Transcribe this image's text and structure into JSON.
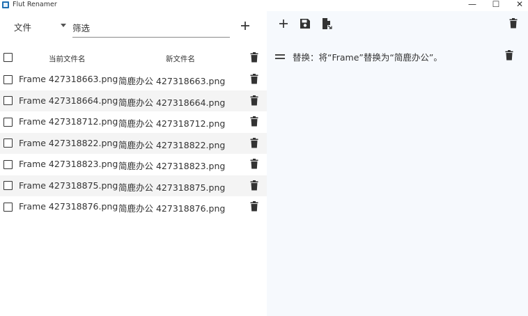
{
  "window": {
    "title": "Flut Renamer",
    "minimize_glyph": "—",
    "maximize_glyph": "☐",
    "close_glyph": "✕"
  },
  "left": {
    "file_menu_label": "文件",
    "filter_placeholder": "筛选",
    "columns": {
      "current": "当前文件名",
      "new": "新文件名"
    },
    "rows": [
      {
        "current": "Frame 427318663.png",
        "new": "简鹿办公 427318663.png"
      },
      {
        "current": "Frame 427318664.png",
        "new": "简鹿办公 427318664.png"
      },
      {
        "current": "Frame 427318712.png",
        "new": "简鹿办公 427318712.png"
      },
      {
        "current": "Frame 427318822.png",
        "new": "简鹿办公 427318822.png"
      },
      {
        "current": "Frame 427318823.png",
        "new": "简鹿办公 427318823.png"
      },
      {
        "current": "Frame 427318875.png",
        "new": "简鹿办公 427318875.png"
      },
      {
        "current": "Frame 427318876.png",
        "new": "简鹿办公 427318876.png"
      }
    ]
  },
  "right": {
    "rules": [
      {
        "text": "替换：将“Frame”替换为“简鹿办公”。"
      }
    ]
  },
  "icons": {
    "plus": "plus-icon",
    "save": "save-icon",
    "file_export": "file-export-icon",
    "trash": "trash-icon",
    "drag": "drag-handle-icon",
    "dropdown": "chevron-down-icon"
  },
  "colors": {
    "right_pane_bg": "#f6f9fd",
    "alt_row_bg": "#f4f4f4",
    "icon": "#333333"
  }
}
